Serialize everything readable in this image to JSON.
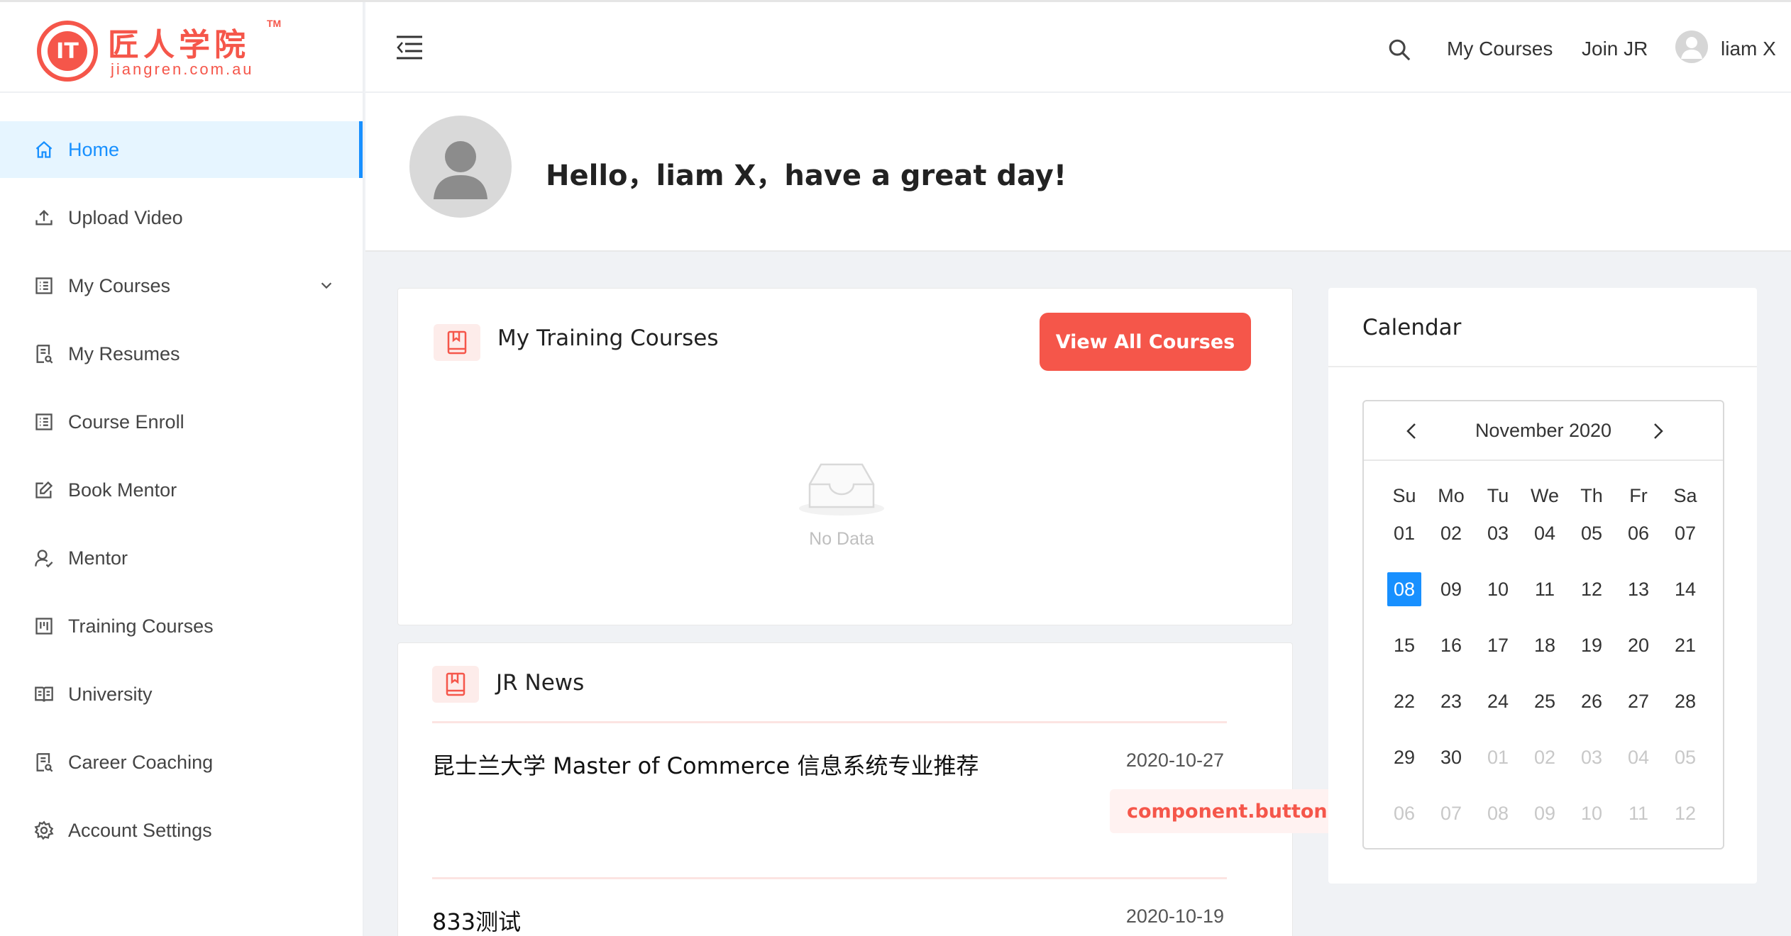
{
  "brand": {
    "name": "匠人学院",
    "tm": "TM",
    "url": "jiangren.com.au",
    "mark": "IT"
  },
  "sidebar": {
    "items": [
      {
        "label": "Home",
        "icon": "home-icon"
      },
      {
        "label": "Upload Video",
        "icon": "upload-icon"
      },
      {
        "label": "My Courses",
        "icon": "list-icon"
      },
      {
        "label": "My Resumes",
        "icon": "resume-icon"
      },
      {
        "label": "Course Enroll",
        "icon": "list-icon"
      },
      {
        "label": "Book Mentor",
        "icon": "edit-icon"
      },
      {
        "label": "Mentor",
        "icon": "user-icon"
      },
      {
        "label": "Training Courses",
        "icon": "board-icon"
      },
      {
        "label": "University",
        "icon": "book-icon"
      },
      {
        "label": "Career Coaching",
        "icon": "resume-icon"
      },
      {
        "label": "Account Settings",
        "icon": "gear-icon"
      }
    ]
  },
  "header": {
    "links": {
      "my_courses": "My Courses",
      "join_jr": "Join JR"
    },
    "user_name": "liam X"
  },
  "welcome": {
    "greeting": "Hello，liam X，have a great day!"
  },
  "training": {
    "title": "My Training Courses",
    "view_all": "View All Courses",
    "empty": "No Data"
  },
  "news": {
    "title": "JR News",
    "items": [
      {
        "title": "昆士兰大学 Master of Commerce 信息系统专业推荐",
        "date": "2020-10-27"
      },
      {
        "title": "833测试",
        "date": "2020-10-19"
      }
    ],
    "tag_button": "component.button.re"
  },
  "calendar": {
    "title": "Calendar",
    "month": "November 2020",
    "weekdays": [
      "Su",
      "Mo",
      "Tu",
      "We",
      "Th",
      "Fr",
      "Sa"
    ],
    "weeks": [
      [
        "01",
        "02",
        "03",
        "04",
        "05",
        "06",
        "07"
      ],
      [
        "08",
        "09",
        "10",
        "11",
        "12",
        "13",
        "14"
      ],
      [
        "15",
        "16",
        "17",
        "18",
        "19",
        "20",
        "21"
      ],
      [
        "22",
        "23",
        "24",
        "25",
        "26",
        "27",
        "28"
      ],
      [
        "29",
        "30",
        "01",
        "02",
        "03",
        "04",
        "05"
      ],
      [
        "06",
        "07",
        "08",
        "09",
        "10",
        "11",
        "12"
      ]
    ],
    "selected": "08"
  },
  "colors": {
    "brand": "#f5564a",
    "accent": "#1890ff"
  }
}
